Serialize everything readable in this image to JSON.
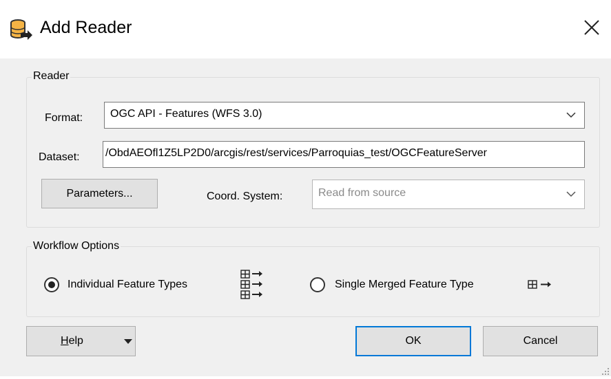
{
  "dialog": {
    "title": "Add Reader",
    "icon": "database-add-icon",
    "close_icon": "close-icon"
  },
  "reader": {
    "group_label": "Reader",
    "format_label": "Format:",
    "format_value": "OGC API - Features (WFS 3.0)",
    "dataset_label": "Dataset:",
    "dataset_value": "/ObdAEOfl1Z5LP2D0/arcgis/rest/services/Parroquias_test/OGCFeatureServer",
    "parameters_button": "Parameters...",
    "coord_label": "Coord. System:",
    "coord_value": "Read from source"
  },
  "workflow": {
    "group_label": "Workflow Options",
    "option_individual": "Individual Feature Types",
    "option_merged": "Single Merged Feature Type",
    "selected": "Individual Feature Types"
  },
  "buttons": {
    "help_first": "H",
    "help_rest": "elp",
    "ok": "OK",
    "cancel": "Cancel"
  },
  "colors": {
    "accent": "#0078d7",
    "client_bg": "#f0f0f0",
    "button_bg": "#e1e1e1"
  }
}
